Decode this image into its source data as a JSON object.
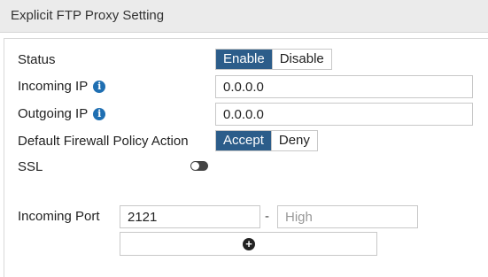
{
  "header": {
    "title": "Explicit FTP Proxy Setting"
  },
  "status": {
    "label": "Status",
    "options": [
      "Enable",
      "Disable"
    ],
    "selected": "Enable"
  },
  "incoming_ip": {
    "label": "Incoming IP",
    "value": "0.0.0.0",
    "info_icon": "info-icon"
  },
  "outgoing_ip": {
    "label": "Outgoing IP",
    "value": "0.0.0.0",
    "info_icon": "info-icon"
  },
  "default_policy": {
    "label": "Default Firewall Policy Action",
    "options": [
      "Accept",
      "Deny"
    ],
    "selected": "Accept"
  },
  "ssl": {
    "label": "SSL",
    "enabled": false
  },
  "incoming_port": {
    "label": "Incoming Port",
    "low_value": "2121",
    "separator": "-",
    "high_placeholder": "High",
    "add_icon": "plus-circle-icon"
  },
  "colors": {
    "accent": "#2c5d8a",
    "info": "#1f6fb2",
    "header_bg": "#ebebeb"
  }
}
